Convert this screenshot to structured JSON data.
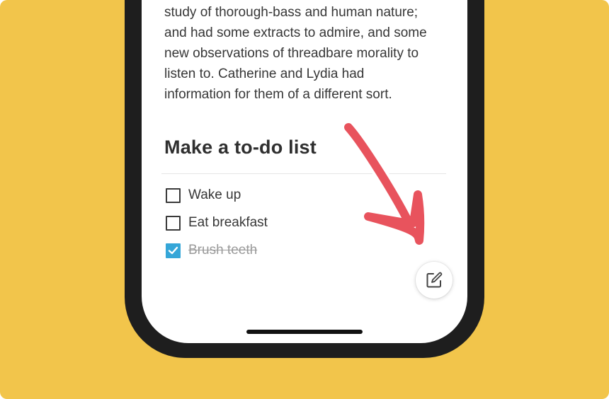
{
  "note": {
    "paragraph_lines": [
      "study of thorough-bass and human nature;",
      "and had some extracts to admire, and some",
      "new observations of threadbare morality to",
      "listen to. Catherine and Lydia had",
      "information for them of a different sort."
    ],
    "heading": "Make a to-do list",
    "todos": [
      {
        "label": "Wake up",
        "checked": false
      },
      {
        "label": "Eat breakfast",
        "checked": false
      },
      {
        "label": "Brush teeth",
        "checked": true
      }
    ]
  },
  "fab": {
    "icon": "compose-icon"
  },
  "colors": {
    "background": "#F2C54B",
    "arrow": "#E8535D",
    "checkbox_checked": "#35A6D8",
    "phone_bezel": "#1e1e1e"
  }
}
